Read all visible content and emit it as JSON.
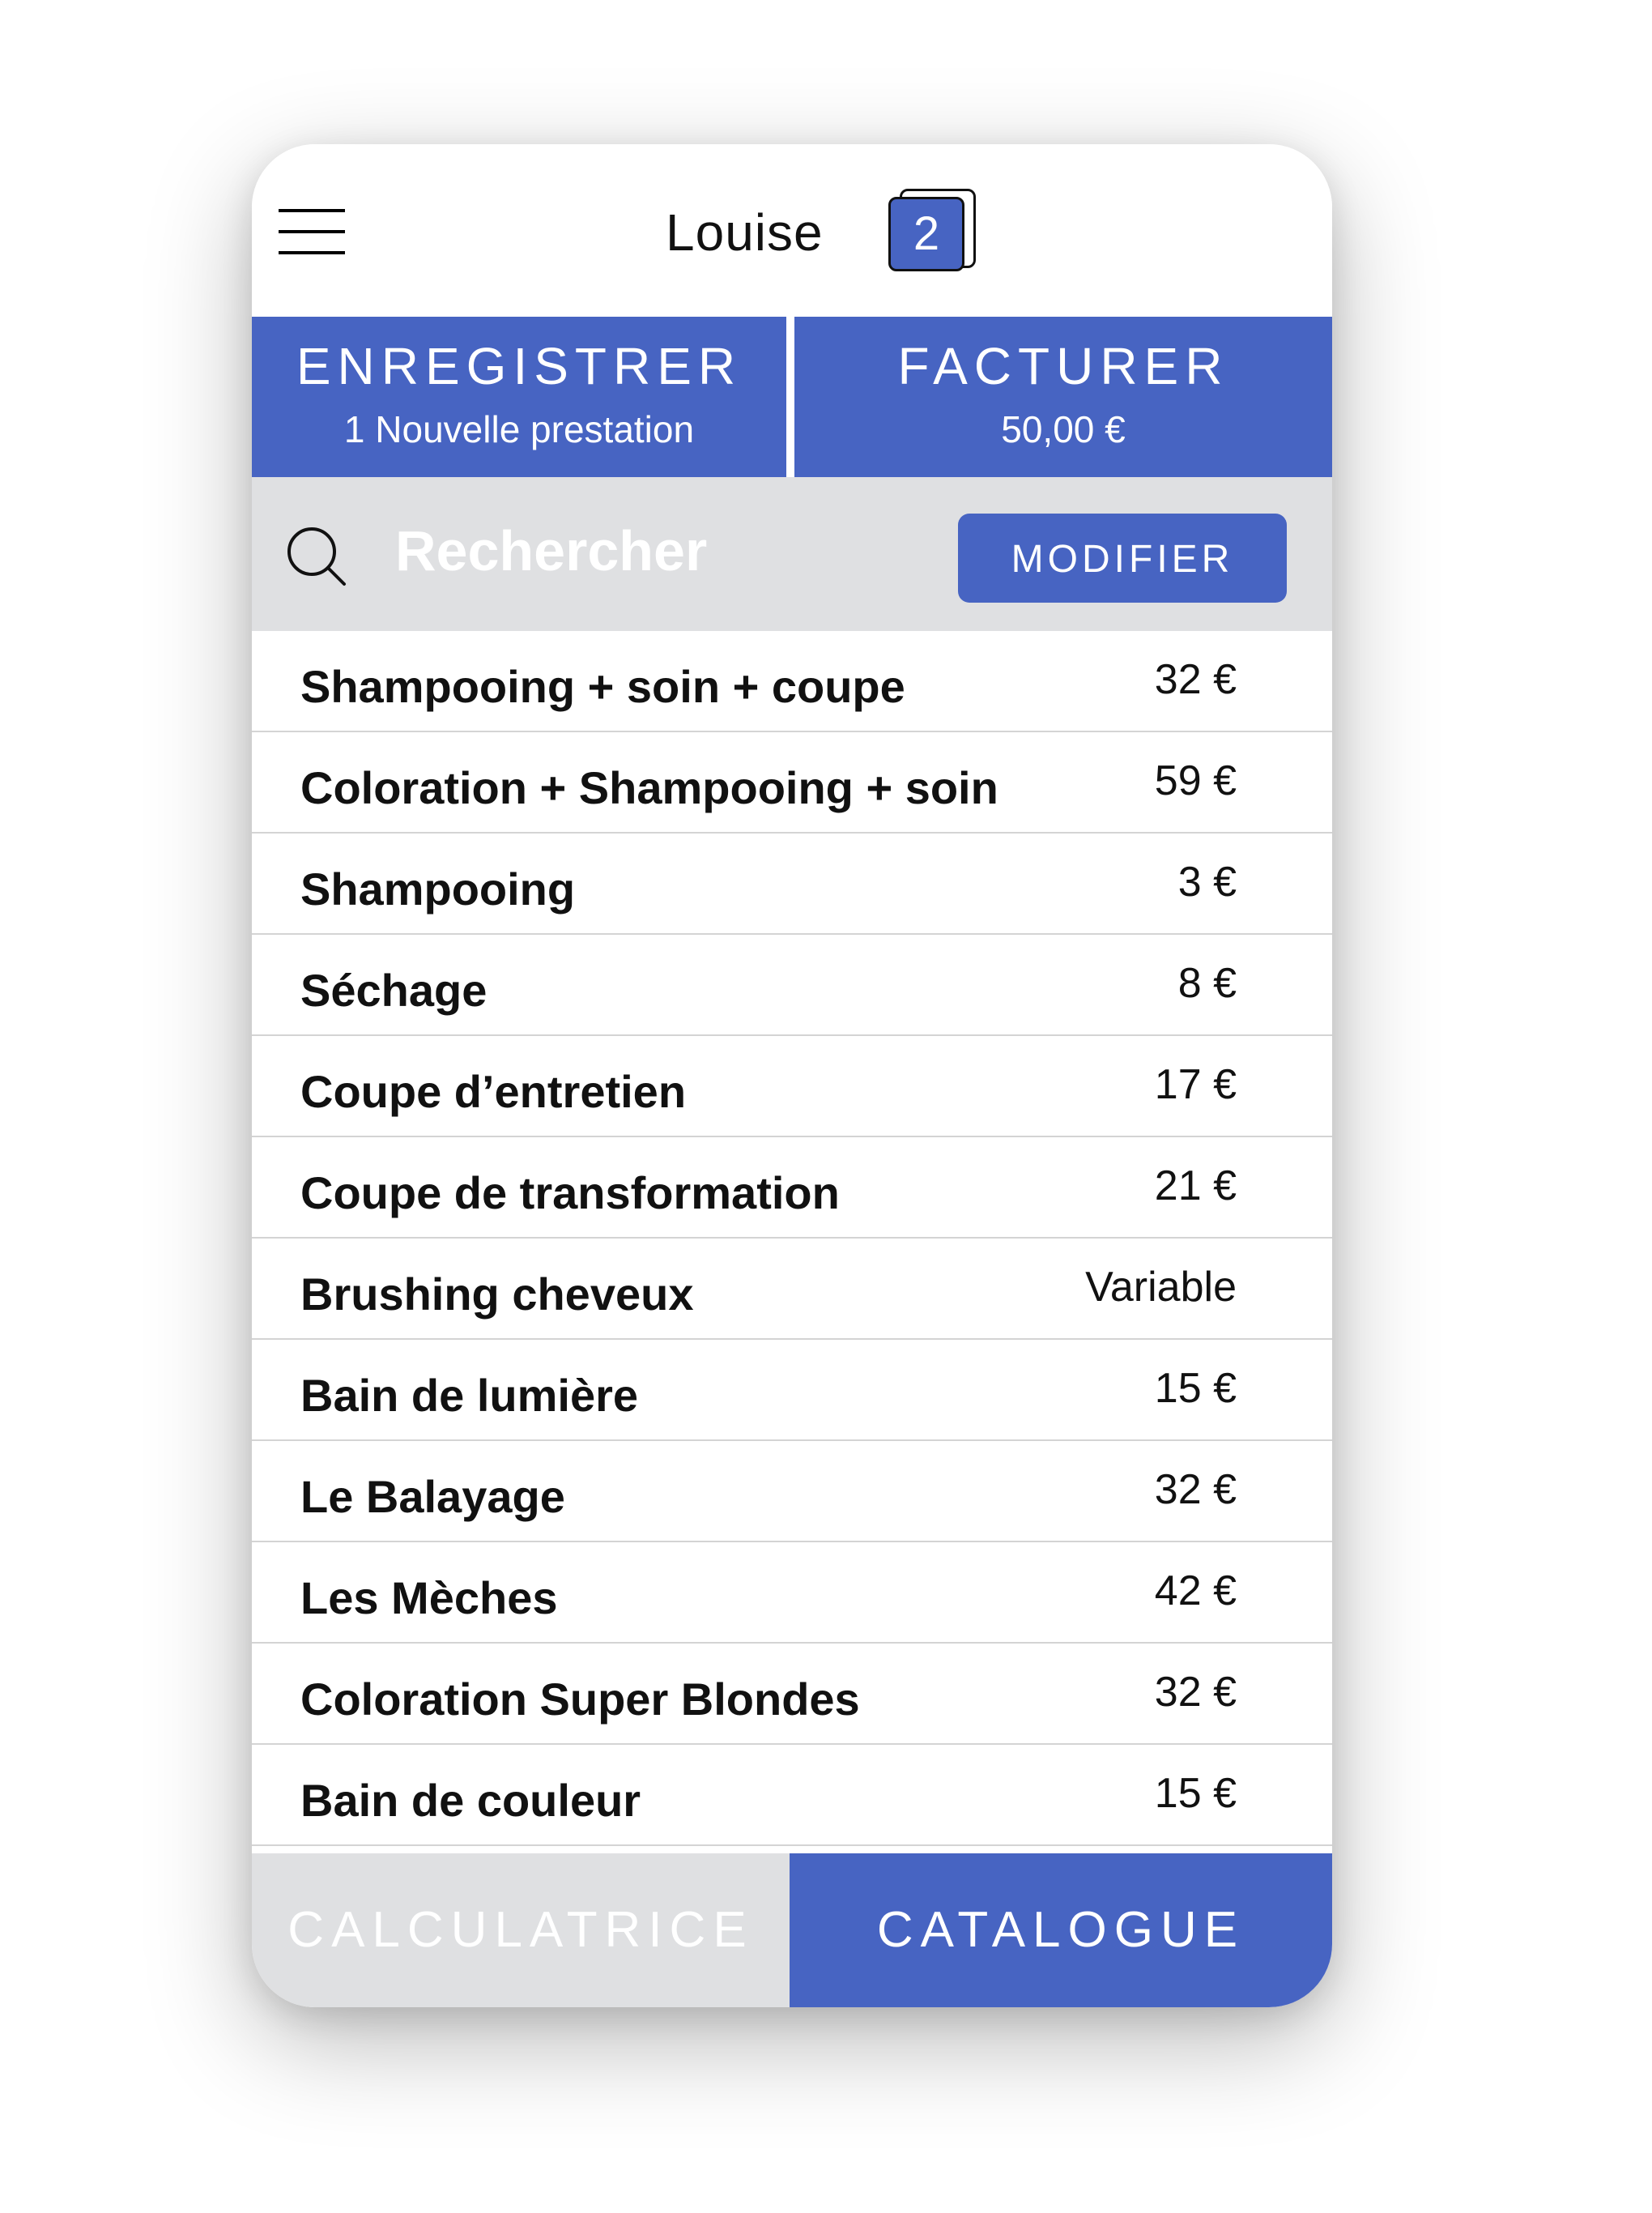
{
  "header": {
    "client_name": "Louise",
    "badge_count": "2"
  },
  "actions": {
    "save": {
      "title": "ENREGISTRER",
      "subtitle": "1 Nouvelle prestation"
    },
    "invoice": {
      "title": "FACTURER",
      "subtitle": "50,00 €"
    }
  },
  "search": {
    "placeholder": "Rechercher",
    "modify_label": "MODIFIER"
  },
  "services": [
    {
      "name": "Shampooing + soin + coupe",
      "price": "32 €"
    },
    {
      "name": "Coloration + Shampooing + soin",
      "price": "59 €"
    },
    {
      "name": "Shampooing",
      "price": "3 €"
    },
    {
      "name": "Séchage",
      "price": "8 €"
    },
    {
      "name": "Coupe d’entretien",
      "price": "17 €"
    },
    {
      "name": "Coupe de transformation",
      "price": "21 €"
    },
    {
      "name": "Brushing cheveux",
      "price": "Variable"
    },
    {
      "name": "Bain de lumière",
      "price": "15 €"
    },
    {
      "name": "Le Balayage",
      "price": "32 €"
    },
    {
      "name": "Les Mèches",
      "price": "42 €"
    },
    {
      "name": "Coloration Super Blondes",
      "price": "32 €"
    },
    {
      "name": "Bain de couleur",
      "price": "15 €"
    }
  ],
  "bottom_tabs": {
    "calculator": "CALCULATRICE",
    "catalogue": "CATALOGUE",
    "active": "catalogue"
  },
  "colors": {
    "accent": "#4764c2",
    "bar_grey": "#dfe0e2"
  }
}
